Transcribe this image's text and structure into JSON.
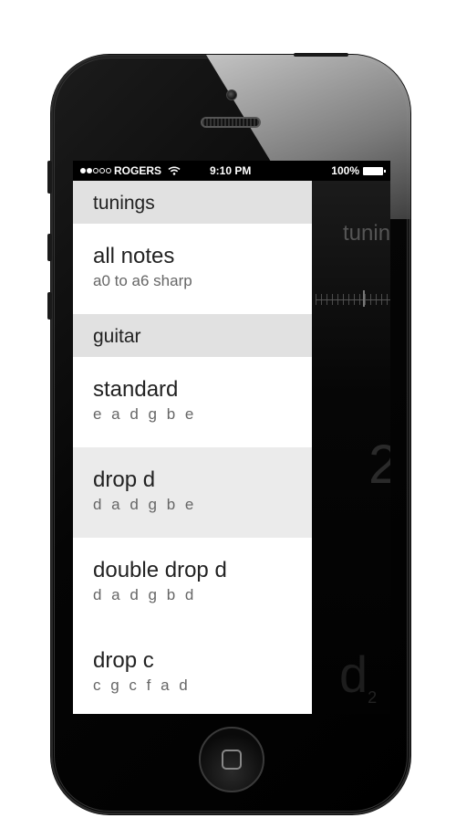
{
  "status_bar": {
    "carrier": "ROGERS",
    "time": "9:10 PM",
    "battery": "100%",
    "signal_bars_filled": 2,
    "signal_bars_total": 5
  },
  "panel": {
    "sections": [
      {
        "header": "tunings",
        "items": [
          {
            "name": "all notes",
            "notes": "a0 to a6 sharp"
          }
        ]
      },
      {
        "header": "guitar",
        "items": [
          {
            "name": "standard",
            "notes": "e a d g b e"
          },
          {
            "name": "drop d",
            "notes": "d a d g b e"
          },
          {
            "name": "double drop d",
            "notes": "d a d g b d"
          },
          {
            "name": "drop c",
            "notes": "c g c f a d"
          }
        ]
      }
    ]
  },
  "tuner": {
    "title": "tunin",
    "big_digit": "2",
    "note": "d",
    "octave": "2"
  },
  "icons": {
    "wifi": "wifi-icon",
    "battery": "battery-icon",
    "camera": "camera-icon",
    "speaker": "speaker-grille-icon",
    "home": "home-button-icon"
  }
}
